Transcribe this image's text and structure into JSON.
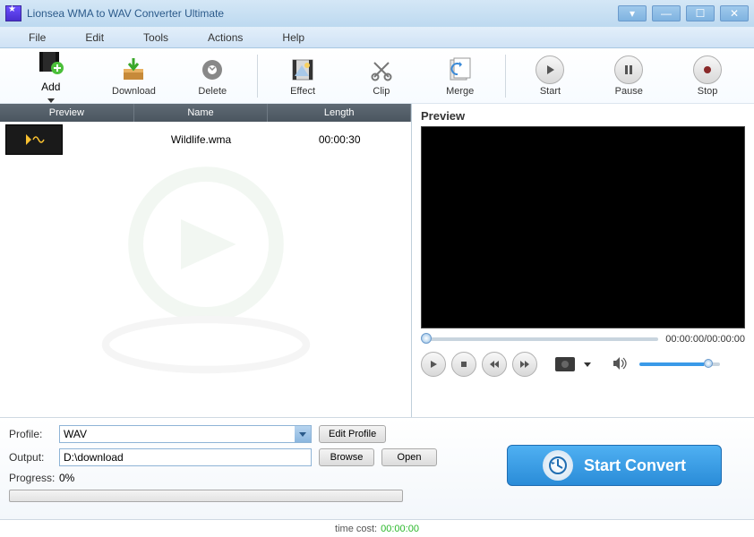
{
  "window": {
    "title": "Lionsea WMA to WAV Converter Ultimate"
  },
  "menu": {
    "file": "File",
    "edit": "Edit",
    "tools": "Tools",
    "actions": "Actions",
    "help": "Help"
  },
  "toolbar": {
    "add": "Add",
    "download": "Download",
    "delete": "Delete",
    "effect": "Effect",
    "clip": "Clip",
    "merge": "Merge",
    "start": "Start",
    "pause": "Pause",
    "stop": "Stop"
  },
  "list": {
    "headers": {
      "preview": "Preview",
      "name": "Name",
      "length": "Length"
    },
    "rows": [
      {
        "name": "Wildlife.wma",
        "length": "00:00:30"
      }
    ]
  },
  "preview": {
    "label": "Preview",
    "time_current": "00:00:00",
    "time_total": "00:00:00"
  },
  "profile": {
    "label": "Profile:",
    "value": "WAV",
    "edit_btn": "Edit Profile"
  },
  "output": {
    "label": "Output:",
    "value": "D:\\download",
    "browse_btn": "Browse",
    "open_btn": "Open"
  },
  "progress": {
    "label": "Progress:",
    "value": "0%"
  },
  "convert_btn": "Start Convert",
  "footer": {
    "label": "time cost:",
    "value": "00:00:00"
  }
}
